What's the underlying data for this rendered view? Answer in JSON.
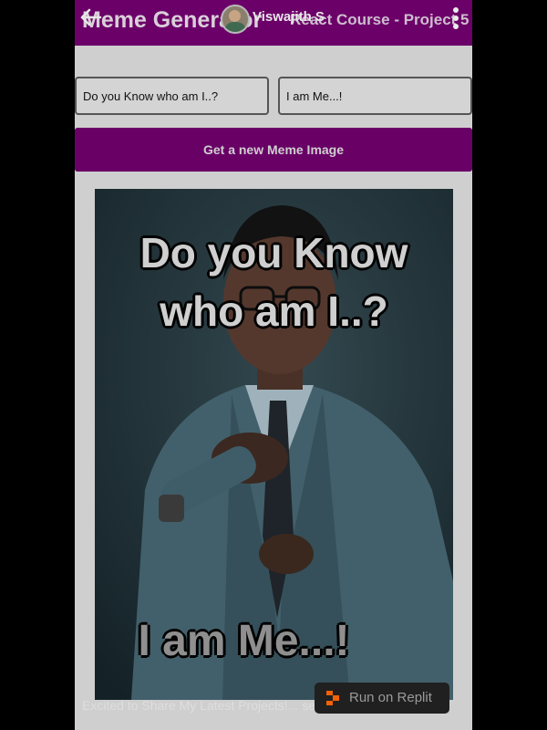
{
  "header": {
    "title": "Meme Generator",
    "subtitle": "React Course - Project 5",
    "accent_color": "#690066"
  },
  "overlay": {
    "user_name": "Viswajith S",
    "caption": "Excited to Share My Latest Projects!... see more",
    "run_button_label": "Run on Replit",
    "icons": [
      "back-arrow-icon",
      "avatar",
      "more-vert-icon",
      "replit-logo-icon"
    ]
  },
  "form": {
    "top_text_value": "Do you Know who am I..?",
    "bottom_text_value": "I am Me...!",
    "button_label": "Get a new Meme Image"
  },
  "meme": {
    "top_text": "Do you Know who am I..?",
    "bottom_text": "I am Me...!"
  }
}
